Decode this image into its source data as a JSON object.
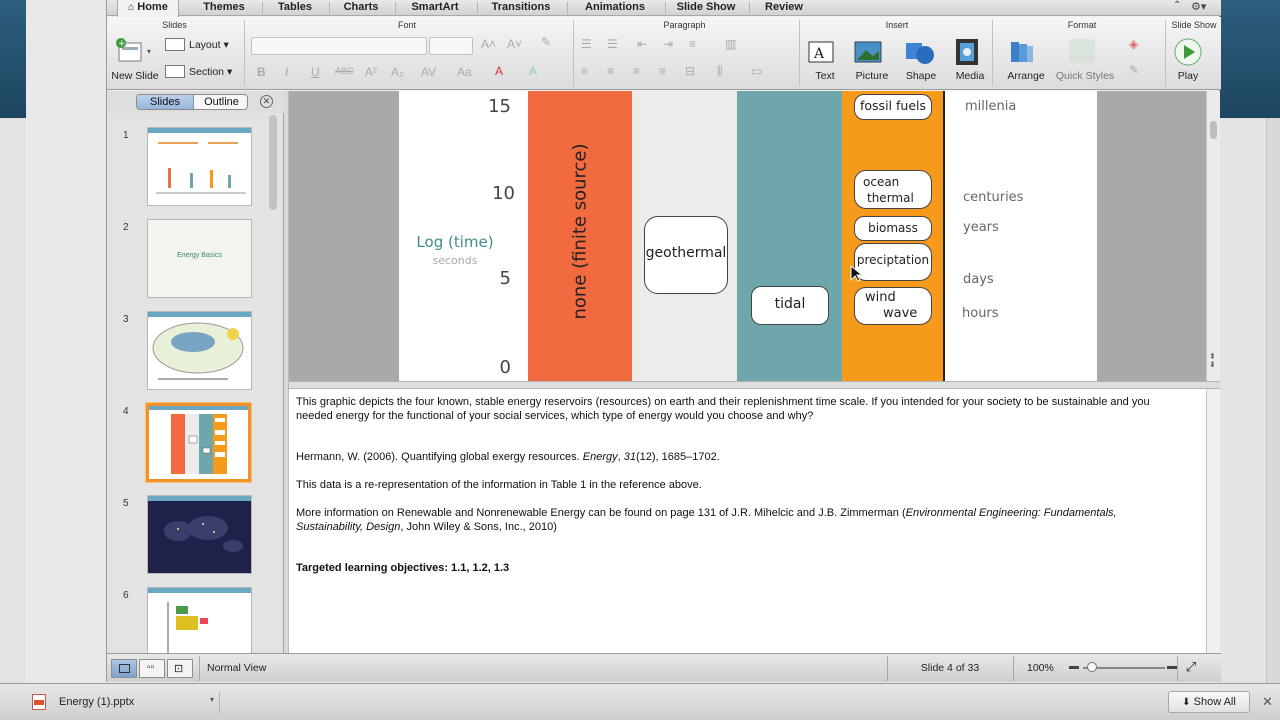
{
  "ribbon_tabs": [
    "Home",
    "Themes",
    "Tables",
    "Charts",
    "SmartArt",
    "Transitions",
    "Animations",
    "Slide Show",
    "Review"
  ],
  "ribbon": {
    "groups": {
      "slides": "Slides",
      "font": "Font",
      "paragraph": "Paragraph",
      "insert": "Insert",
      "format": "Format",
      "slideshow": "Slide Show"
    },
    "new_slide": "New Slide",
    "layout": "Layout",
    "section": "Section",
    "text": "Text",
    "picture": "Picture",
    "shape": "Shape",
    "media": "Media",
    "arrange": "Arrange",
    "quick_styles": "Quick Styles",
    "play": "Play"
  },
  "sidebar": {
    "tab_slides": "Slides",
    "tab_outline": "Outline",
    "slide_numbers": [
      "1",
      "2",
      "3",
      "4",
      "5",
      "6"
    ],
    "thumb2_text": "Energy Basics"
  },
  "slide": {
    "y_ticks": [
      "15",
      "10",
      "5",
      "0"
    ],
    "axis_title": "Log (time)",
    "axis_sub": "seconds",
    "band_text": "none (finite source)",
    "geothermal": "geothermal",
    "tidal": "tidal",
    "fossil": "fossil fuels",
    "ocean1": "ocean",
    "ocean2": "thermal",
    "biomass": "biomass",
    "precip": "preciptation",
    "wind1": "wind",
    "wind2": "wave",
    "right_labels": [
      "millenia",
      "centuries",
      "years",
      "days",
      "hours"
    ],
    "colors": {
      "orange_red": "#f26a3f",
      "beige": "#ececea",
      "teal": "#6ea6ac",
      "orange": "#f59a1b"
    }
  },
  "notes": {
    "p1": "This graphic depicts the four known, stable energy reservoirs (resources) on earth and their replenishment time scale.  If you intended for your society to be sustainable and you needed energy for the functional of your social services, which type of energy would you choose and why?",
    "p2_a": "Hermann, W. (2006). Quantifying global exergy resources. ",
    "p2_b": "Energy",
    "p2_c": ", ",
    "p2_d": "31",
    "p2_e": "(12), 1685–1702.",
    "p3": "This data is a re-representation of the information in Table 1 in the reference above.",
    "p4_a": "More information on Renewable and Nonrenewable Energy can be found on page 131 of J.R. Mihelcic and J.B. Zimmerman (",
    "p4_b": "Environmental Engineering: Fundamentals, Sustainability, Design",
    "p4_c": ", John Wiley & Sons, Inc., 2010)",
    "p5": "Targeted learning objectives: 1.1, 1.2, 1.3"
  },
  "status": {
    "view": "Normal View",
    "slide_pos": "Slide 4 of 33",
    "zoom": "100%"
  },
  "dock": {
    "file": "Energy (1).pptx",
    "show_all": "Show All"
  }
}
